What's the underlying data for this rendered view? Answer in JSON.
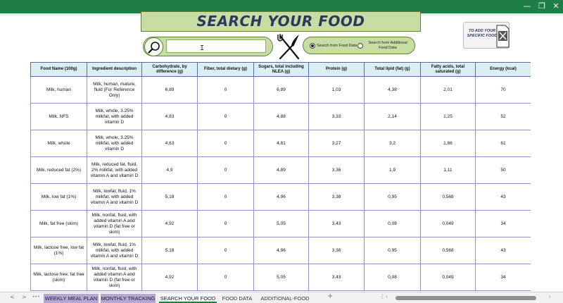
{
  "window": {
    "controls": {
      "minimize": "—",
      "restore": "❐",
      "close": "✕"
    }
  },
  "header": {
    "title": "SEARCH YOUR FOOD"
  },
  "search": {
    "value": "",
    "cursor": "I"
  },
  "radio": {
    "option1": "Search from Food Data",
    "option2": "Search from Additional Food Data",
    "selected": "option1"
  },
  "add_food": {
    "label": "TO ADD YOUR SPECIFIC FOOD"
  },
  "table": {
    "columns": [
      "Food Name (100g)",
      "Ingredient description",
      "Carbohydrate, by difference (g)",
      "Fiber, total dietary (g)",
      "Sugars, total including NLEA (g)",
      "Protein (g)",
      "Total lipid (fat) (g)",
      "Fatty acids, total saturated (g)",
      "Energy (kcal)"
    ],
    "rows": [
      [
        "Milk, human",
        "Milk, human, mature, fluid (For Reference Only)",
        "6,89",
        "0",
        "6,89",
        "1,03",
        "4,38",
        "2,01",
        "70"
      ],
      [
        "Milk, NFS",
        "Milk, whole, 3.25% milkfat, with added vitamin D",
        "4,83",
        "0",
        "4,88",
        "3,33",
        "2,14",
        "1,25",
        "52"
      ],
      [
        "Milk, whole",
        "Milk, whole, 3.25% milkfat, with added vitamin D",
        "4,63",
        "0",
        "4,81",
        "3,27",
        "3,2",
        "1,86",
        "61"
      ],
      [
        "Milk, reduced fat (2%)",
        "Milk, reduced fat, fluid, 2% milkfat, with added vitamin A and vitamin D",
        "4,9",
        "0",
        "4,89",
        "3,36",
        "1,9",
        "1,11",
        "50"
      ],
      [
        "Milk, low fat (1%)",
        "Milk, lowfat, fluid, 1% milkfat, with added vitamin A and vitamin D",
        "5,18",
        "0",
        "4,96",
        "3,38",
        "0,95",
        "0,568",
        "43"
      ],
      [
        "Milk, fat free (skim)",
        "Milk, nonfat, fluid, with added vitamin A and vitamin D (fat free or skim)",
        "4,92",
        "0",
        "5,05",
        "3,43",
        "0,08",
        "0,049",
        "34"
      ],
      [
        "Milk, lactose free, low fat (1%)",
        "Milk, lowfat, fluid, 1% milkfat, with added vitamin A and vitamin D",
        "5,18",
        "0",
        "4,96",
        "3,38",
        "0,95",
        "0,568",
        "43"
      ],
      [
        "Milk, lactose free, fat free (skim)",
        "Milk, nonfat, fluid, with added vitamin A and vitamin D (fat free or skim)",
        "4,92",
        "0",
        "5,05",
        "3,43",
        "0,08",
        "0,049",
        "34"
      ]
    ]
  },
  "tabs": {
    "nav": {
      "prev": "<",
      "next": ">",
      "more": "•••",
      "add": "+",
      "menu": "⋮"
    },
    "items": [
      {
        "label": "WEEKLY MEAL PLAN",
        "style": "purple"
      },
      {
        "label": "MONTHLY TRACKING",
        "style": "purple"
      },
      {
        "label": "SEARCH YOUR FOOD",
        "style": "active"
      },
      {
        "label": "FOOD DATA",
        "style": "plain"
      },
      {
        "label": "ADDITIONAL-FOOD",
        "style": "plain"
      }
    ]
  },
  "colors": {
    "titlebar": "#1e7e45",
    "title_fill": "#c7dda3",
    "header_fill": "#daeef3",
    "tab_purple": "#b4a7d6"
  }
}
